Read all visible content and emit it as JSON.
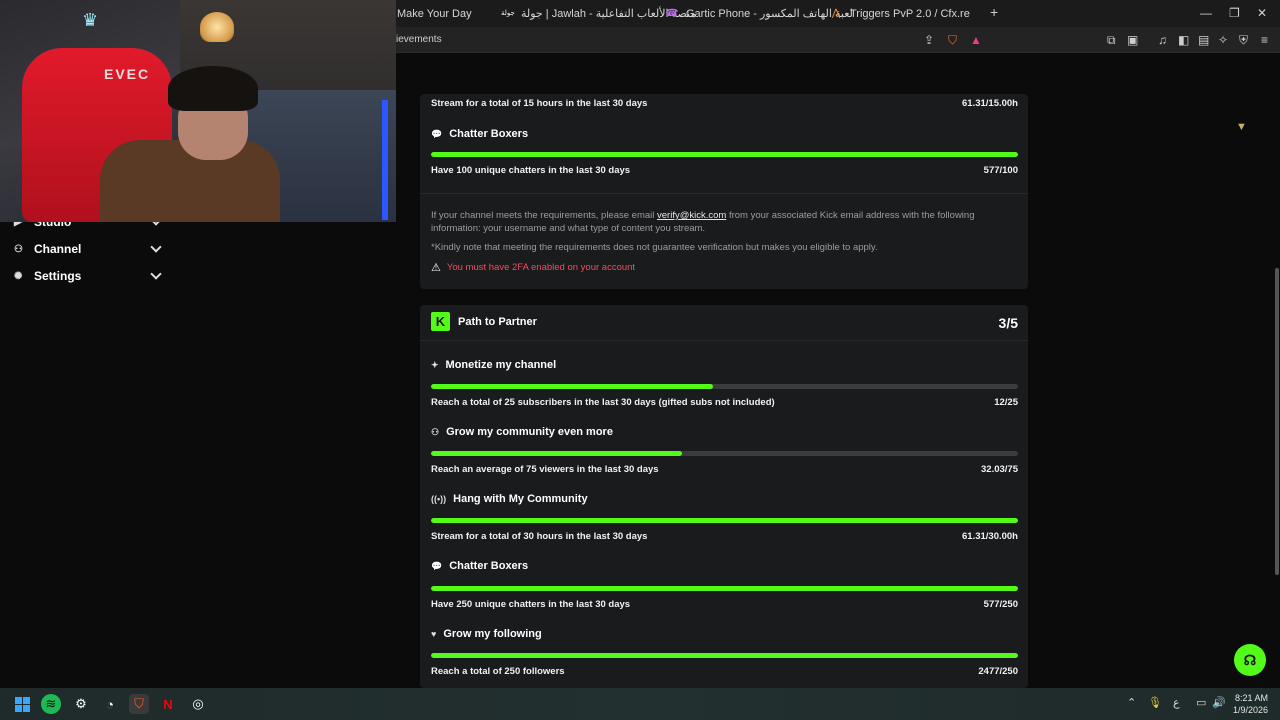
{
  "browser": {
    "tabs": [
      {
        "label": "Make Your Day",
        "icon": ""
      },
      {
        "label": "جولة | Jawlah - منصة الألعاب التفاعلية",
        "icon": "jawlah-icon"
      },
      {
        "label": "Gartic Phone - لعبة الهاتف المكسور",
        "icon": "phone-icon"
      },
      {
        "label": "Triggers PvP 2.0 / Cfx.re",
        "icon": "cfx-icon"
      }
    ],
    "new_tab": "+",
    "url": "ievements"
  },
  "sidebar": {
    "items": [
      {
        "label": "Studio",
        "icon": "studio-icon"
      },
      {
        "label": "Channel",
        "icon": "channel-icon"
      },
      {
        "label": "Settings",
        "icon": "gear-icon"
      }
    ]
  },
  "verification_card": {
    "requirements": [
      {
        "title": "",
        "description": "Stream for a total of 15 hours in the last 30 days",
        "value": "61.31/15.00h",
        "progress": 1.0
      },
      {
        "title": "Chatter Boxers",
        "icon": "chat-icon",
        "description": "Have 100 unique chatters in the last 30 days",
        "value": "577/100",
        "progress": 1.0
      }
    ],
    "info_line1_pre": "If your channel meets the requirements, please email ",
    "info_email": "verify@kick.com",
    "info_line1_post": " from your associated Kick email address with the following information: your username and what type of content you stream.",
    "info_line2": "*Kindly note that meeting the requirements does not guarantee verification but makes you eligible to apply.",
    "warning": "You must have 2FA enabled on your account"
  },
  "partner_card": {
    "logo": "K",
    "title": "Path to Partner",
    "count": "3/5",
    "requirements": [
      {
        "title": "Monetize my channel",
        "icon": "sparkle-icon",
        "description": "Reach a total of 25 subscribers in the last 30 days (gifted subs not included)",
        "value": "12/25",
        "progress": 0.48
      },
      {
        "title": "Grow my community even more",
        "icon": "users-icon",
        "description": "Reach an average of 75 viewers in the last 30 days",
        "value": "32.03/75",
        "progress": 0.427
      },
      {
        "title": "Hang with My Community",
        "icon": "broadcast-icon",
        "description": "Stream for a total of 30 hours in the last 30 days",
        "value": "61.31/30.00h",
        "progress": 1.0
      },
      {
        "title": "Chatter Boxers",
        "icon": "chat-icon",
        "description": "Have 250 unique chatters in the last 30 days",
        "value": "577/250",
        "progress": 1.0
      },
      {
        "title": "Grow my following",
        "icon": "heart-icon",
        "description": "Reach a total of 250 followers",
        "value": "2477/250",
        "progress": 1.0
      }
    ]
  },
  "webcam": {
    "chair_text": "EVEC"
  },
  "taskbar": {
    "time": "8:21 AM",
    "date": "1/9/2026",
    "lang": "ع"
  },
  "colors": {
    "accent": "#53fc18",
    "warning": "#f04f5f",
    "card": "#191b1c"
  }
}
